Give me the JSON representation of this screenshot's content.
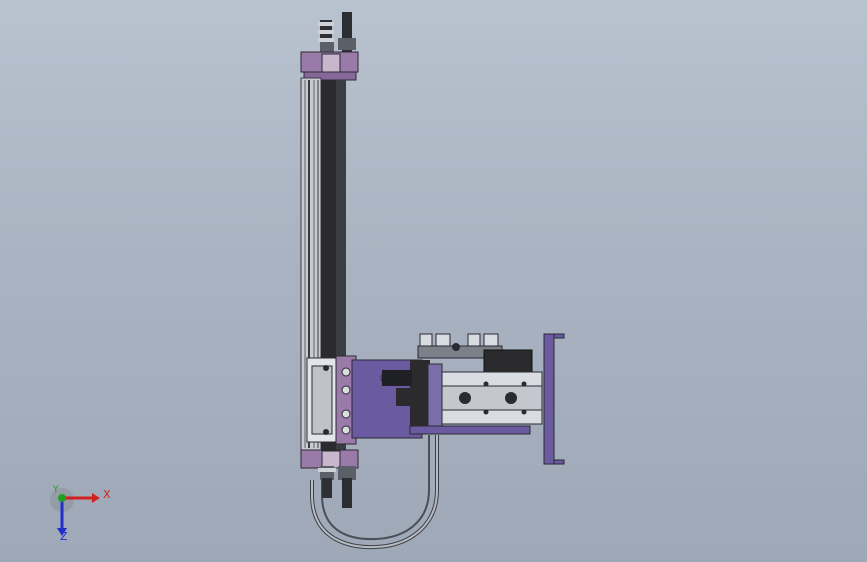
{
  "viewport": {
    "background_top": "#b9c2cf",
    "background_bottom": "#9ea8b6"
  },
  "model": {
    "name": "",
    "part_colors": {
      "plate": "#6a5aa0",
      "bracket": "#9a7aa8",
      "cylinder_dark": "#2b2b2e",
      "rail_light": "#c8ccd2",
      "metal": "#7d838c",
      "hose": "#5a5e66"
    }
  },
  "triad": {
    "x_label": "X",
    "y_label": "Y",
    "z_label": "Z",
    "x_color": "#d42020",
    "y_color": "#1fa01f",
    "z_color": "#2030c8"
  }
}
